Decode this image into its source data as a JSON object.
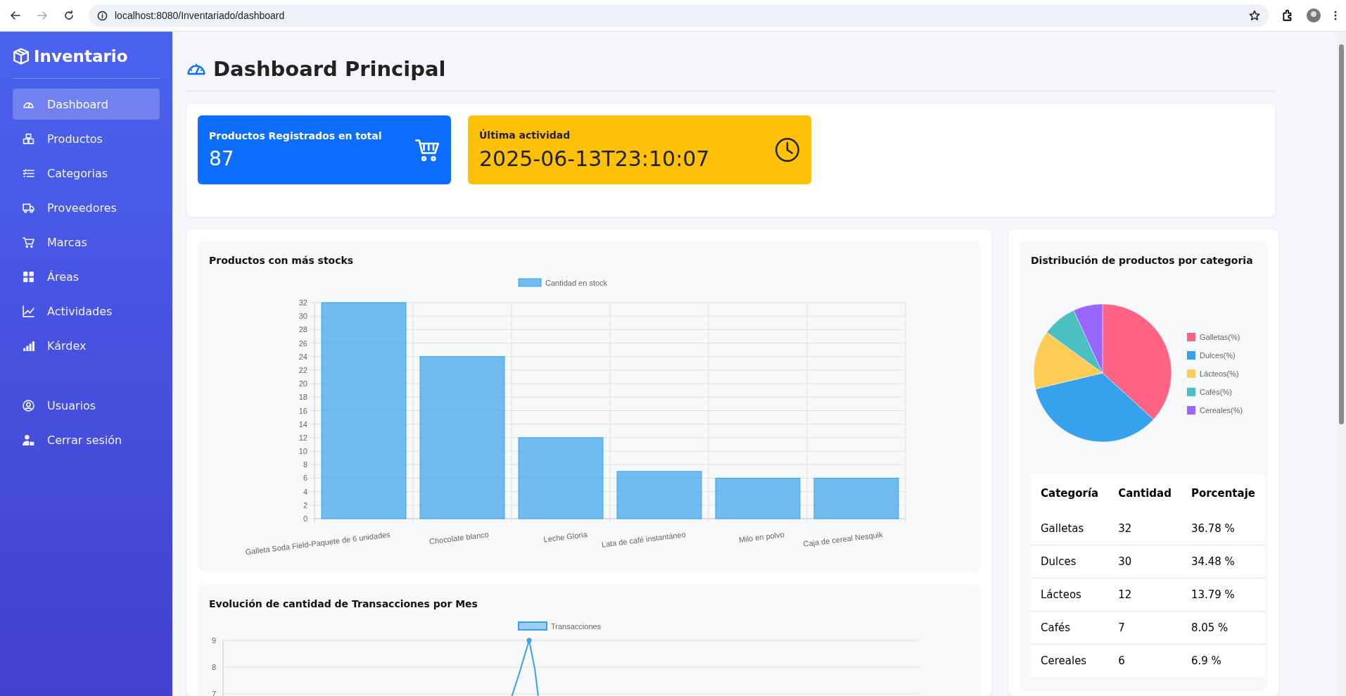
{
  "browser": {
    "url": "localhost:8080/Inventariado/dashboard"
  },
  "sidebar": {
    "brand": "Inventario",
    "items": [
      {
        "label": "Dashboard",
        "selected": true
      },
      {
        "label": "Productos",
        "selected": false
      },
      {
        "label": "Categorias",
        "selected": false
      },
      {
        "label": "Proveedores",
        "selected": false
      },
      {
        "label": "Marcas",
        "selected": false
      },
      {
        "label": "Áreas",
        "selected": false
      },
      {
        "label": "Actividades",
        "selected": false
      },
      {
        "label": "Kárdex",
        "selected": false
      }
    ],
    "bottom_items": [
      {
        "label": "Usuarios",
        "selected": false
      },
      {
        "label": "Cerrar sesión",
        "selected": false
      }
    ]
  },
  "page_title": "Dashboard Principal",
  "stats": [
    {
      "kind": "count",
      "label": "Productos Registrados en total",
      "value": "87",
      "color": "#0d6efd"
    },
    {
      "kind": "time",
      "label": "Última actividad",
      "value": "2025-06-13T23:10:07",
      "color": "#ffc107"
    }
  ],
  "bar_chart": {
    "title": "Productos con más stocks",
    "chart_data": {
      "type": "bar",
      "grid": true,
      "legend": "top",
      "categories": [
        "Galleta Soda Field-Paquete de 6 unidades",
        "Chocolate blanco",
        "Leche Gloria",
        "Lata de café instantáneo",
        "Milo en polvo",
        "Caja de cereal Nesquik"
      ],
      "series": [
        {
          "name": "Cantidad en stock",
          "color": "#36a2eb",
          "values": [
            32,
            24,
            12,
            7,
            6,
            6
          ]
        }
      ],
      "ylim": [
        0,
        32
      ],
      "yticks": [
        0,
        2,
        4,
        6,
        8,
        10,
        12,
        14,
        16,
        18,
        20,
        22,
        24,
        26,
        28,
        30,
        32
      ]
    }
  },
  "pie_chart": {
    "title": "Distribución de productos por categoria",
    "chart_data": {
      "type": "pie",
      "legend": "right",
      "categories": [
        "Galletas(%)",
        "Dulces(%)",
        "Lácteos(%)",
        "Cafés(%)",
        "Cereales(%)"
      ],
      "values": [
        36.78,
        34.48,
        13.79,
        8.05,
        6.9
      ],
      "colors": [
        "#ff6384",
        "#36a2eb",
        "#ffcd56",
        "#4bc0c0",
        "#9966ff"
      ]
    }
  },
  "category_table": {
    "columns": [
      "Categoría",
      "Cantidad",
      "Porcentaje"
    ],
    "rows": [
      [
        "Galletas",
        "32",
        "36.78 %"
      ],
      [
        "Dulces",
        "30",
        "34.48 %"
      ],
      [
        "Lácteos",
        "12",
        "13.79 %"
      ],
      [
        "Cafés",
        "7",
        "8.05 %"
      ],
      [
        "Cereales",
        "6",
        "6.9 %"
      ]
    ]
  },
  "line_chart": {
    "title": "Evolución de cantidad de Transacciones por Mes",
    "legend": "Transacciones",
    "y_ticks": [
      "9",
      "8",
      "7"
    ]
  }
}
